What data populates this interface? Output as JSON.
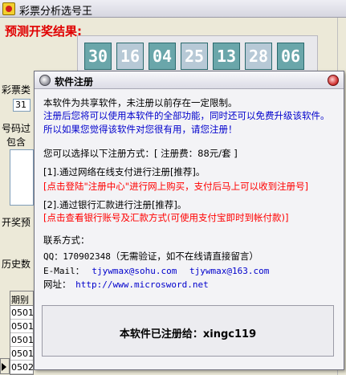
{
  "window": {
    "title": "彩票分析选号王"
  },
  "predict": {
    "label": "预测开奖结果:",
    "numbers": [
      "30",
      "16",
      "04",
      "25",
      "13",
      "28",
      "06"
    ]
  },
  "main_partial": {
    "label_type": "彩票类",
    "type_value": "31",
    "label_number": "号码过",
    "label_contains": "包含",
    "label_open": "开奖预",
    "label_history": "历史数",
    "grid_header": "期别",
    "grid_rows": [
      "0501",
      "0501",
      "0501",
      "0501",
      "0502"
    ]
  },
  "dialog": {
    "title": "软件注册",
    "intro_1": "本软件为共享软件，未注册以前存在一定限制。",
    "intro_2": "注册后您将可以使用本软件的全部功能，同时还可以免费升级该软件。",
    "intro_3": "所以如果您觉得该软件对您很有用，请您注册！",
    "methods": "您可以选择以下注册方式：[ 注册费：88元/套 ]",
    "method_1": "[1].通过网络在线支付进行注册[推荐]。",
    "method_1_link": "[点击登陆\"注册中心\"进行网上购买，支付后马上可以收到注册号]",
    "method_2": "[2].通过银行汇款进行注册[推荐]。",
    "method_2_link": "[点击查看银行账号及汇款方式(可使用支付宝即时到帐付款)]",
    "contact_label": "联系方式：",
    "qq_label": "QQ：",
    "qq_value": "170902348",
    "qq_note": "（无需验证，如不在线请直接留言）",
    "email_label": "E-Mail：",
    "email_1": "tjywmax@sohu.com",
    "email_2": "tjywmax@163.com",
    "site_label": "网址：",
    "site_value": "http://www.microsword.net",
    "registered": "本软件已注册给：xingc119"
  }
}
